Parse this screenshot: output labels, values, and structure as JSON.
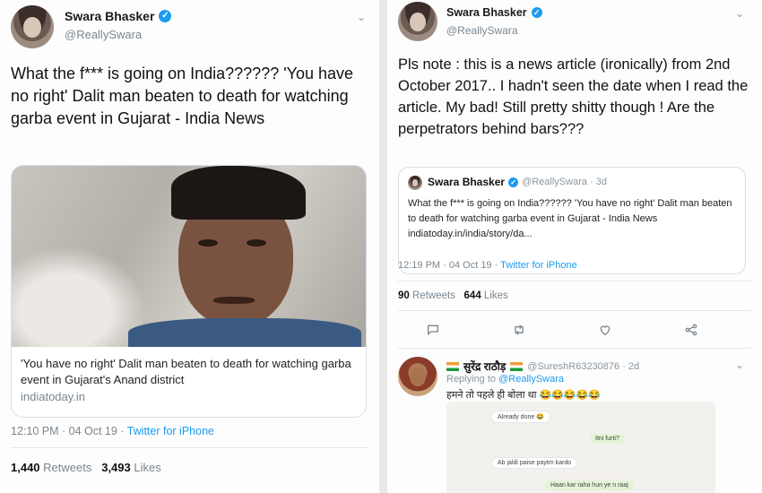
{
  "left_tweet": {
    "author_name": "Swara Bhasker",
    "author_handle": "@ReallySwara",
    "text": "What the f*** is going on India?????? 'You have no right' Dalit man beaten to death for watching garba event in Gujarat - India News",
    "card": {
      "title": "'You have no right' Dalit man beaten to death for watching garba event in Gujarat's Anand district",
      "domain": "indiatoday.in"
    },
    "time": "12:10 PM · 04 Oct 19",
    "source": "Twitter for iPhone",
    "retweets_count": "1,440",
    "retweets_label": "Retweets",
    "likes_count": "3,493",
    "likes_label": "Likes"
  },
  "right_tweet": {
    "author_name": "Swara Bhasker",
    "author_handle": "@ReallySwara",
    "text": "Pls note : this is a news article (ironically) from 2nd October 2017.. I hadn't seen the date when I read the article. My bad! Still pretty shitty though ! Are the perpetrators behind bars???",
    "quoted": {
      "author_name": "Swara Bhasker",
      "author_handle": "@ReallySwara · 3d",
      "text": "What the f*** is going on India?????? 'You have no right' Dalit man beaten to death for watching garba event in Gujarat - India News indiatoday.in/india/story/da..."
    },
    "time": "12:19 PM · 04 Oct 19",
    "source": "Twitter for iPhone",
    "retweets_count": "90",
    "retweets_label": "Retweets",
    "likes_count": "644",
    "likes_label": "Likes"
  },
  "reply": {
    "author_name": "सुरेंद्र राठौड़",
    "author_handle": "@SureshR63230876 · 2d",
    "replying_prefix": "Replying to",
    "replying_handle": "@ReallySwara",
    "text": "हमने तो पहले ही बोला था 😂😂😂😂😂",
    "chat": [
      {
        "text": "Already done 😂"
      },
      {
        "text": "Itni furti?"
      },
      {
        "text": "Ab jaldi paise paytm kardo"
      },
      {
        "text": "Haan kar raha hun ye n raaj"
      }
    ]
  },
  "icons": {
    "reply": "reply-icon",
    "retweet": "retweet-icon",
    "like": "heart-icon",
    "share": "share-icon",
    "chevron": "chevron-down-icon",
    "verified": "verified-badge-icon"
  },
  "colors": {
    "accent": "#1d9bf0",
    "muted": "#7a8791"
  }
}
